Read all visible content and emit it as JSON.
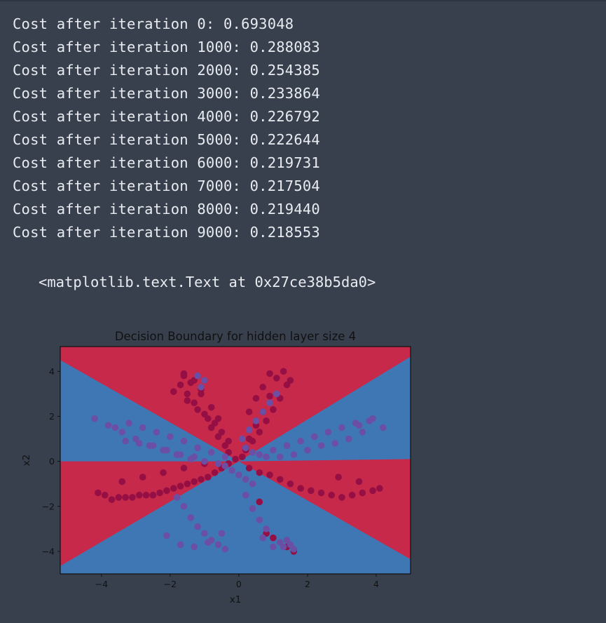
{
  "log_lines": [
    "Cost after iteration 0: 0.693048",
    "Cost after iteration 1000: 0.288083",
    "Cost after iteration 2000: 0.254385",
    "Cost after iteration 3000: 0.233864",
    "Cost after iteration 4000: 0.226792",
    "Cost after iteration 5000: 0.222644",
    "Cost after iteration 6000: 0.219731",
    "Cost after iteration 7000: 0.217504",
    "Cost after iteration 8000: 0.219440",
    "Cost after iteration 9000: 0.218553"
  ],
  "output_text": "<matplotlib.text.Text at 0x27ce38b5da0>",
  "chart_data": {
    "type": "scatter",
    "title": "Decision Boundary for hidden layer size 4",
    "xlabel": "x1",
    "ylabel": "x2",
    "xlim": [
      -5.2,
      5.0
    ],
    "ylim": [
      -5.0,
      5.1
    ],
    "xticks": [
      -4,
      -2,
      0,
      2,
      4
    ],
    "yticks": [
      -4,
      -2,
      0,
      2,
      4
    ],
    "colors": {
      "red_region": "#c6294a",
      "blue_region": "#3f77b4",
      "red_points": "#950f45",
      "blue_points": "#6a4fa5",
      "frame": "#111111"
    },
    "decision_regions": {
      "red": [
        [
          [
            -5.2,
            5.1
          ],
          [
            5.0,
            5.1
          ],
          [
            5.0,
            4.65
          ],
          [
            0,
            0
          ],
          [
            -5.2,
            4.5
          ]
        ],
        [
          [
            -5.2,
            0
          ],
          [
            0,
            0
          ],
          [
            5.0,
            0.1
          ],
          [
            5.0,
            -4.35
          ],
          [
            0,
            0
          ],
          [
            -5.2,
            -4.65
          ]
        ]
      ]
    },
    "series": [
      {
        "label_class": 0,
        "x": [
          -1.6,
          -1.3,
          -1.1,
          -1.9,
          -1.5,
          -1.2,
          -0.9,
          -0.8,
          -0.6,
          -0.4,
          -1.7,
          -1.5,
          -1.3,
          -1.0,
          -0.7,
          -0.5,
          -0.3,
          -1.6,
          -1.4,
          -1.1,
          -0.8,
          -0.6,
          -0.3,
          0.2,
          0.4,
          0.6,
          0.8,
          1.0,
          1.2,
          1.4,
          0.9,
          0.7,
          0.5,
          0.3,
          1.5,
          1.3,
          1.1,
          0.9,
          0.7,
          0.5,
          0.3,
          0.2,
          0.1,
          -0.1,
          -0.3,
          -0.5,
          -0.7,
          -0.9,
          -1.1,
          -1.3,
          -1.5,
          -1.7,
          -1.9,
          -2.1,
          -2.3,
          -2.5,
          -2.7,
          -2.9,
          -3.1,
          -3.3,
          -3.5,
          -3.7,
          -3.9,
          -4.1,
          -3.4,
          -2.8,
          -2.2,
          -1.6,
          -1.0,
          0.3,
          0.6,
          0.9,
          1.2,
          1.5,
          1.8,
          2.1,
          2.4,
          2.7,
          3.0,
          3.3,
          3.6,
          3.9,
          4.1,
          2.9,
          3.5,
          1.0,
          1.4,
          1.6,
          0.6,
          0.8
        ],
        "y": [
          3.9,
          3.6,
          3.2,
          3.1,
          2.7,
          2.3,
          1.9,
          1.5,
          1.1,
          0.7,
          3.4,
          3.0,
          2.6,
          2.1,
          1.7,
          1.3,
          0.9,
          3.8,
          3.5,
          3.0,
          2.4,
          1.9,
          0.4,
          0.6,
          0.9,
          1.3,
          1.8,
          2.3,
          2.8,
          3.4,
          3.9,
          3.3,
          2.8,
          2.2,
          3.6,
          4.0,
          3.7,
          2.9,
          2.2,
          1.6,
          1.0,
          0.5,
          0.2,
          0.1,
          -0.1,
          -0.3,
          -0.5,
          -0.7,
          -0.8,
          -0.9,
          -1.0,
          -1.1,
          -1.2,
          -1.3,
          -1.4,
          -1.5,
          -1.5,
          -1.5,
          -1.6,
          -1.6,
          -1.6,
          -1.7,
          -1.5,
          -1.4,
          -0.9,
          -0.7,
          -0.5,
          -0.3,
          -0.1,
          -0.3,
          -0.5,
          -0.6,
          -0.8,
          -1.0,
          -1.2,
          -1.3,
          -1.4,
          -1.5,
          -1.6,
          -1.5,
          -1.4,
          -1.3,
          -1.2,
          -0.7,
          -0.9,
          -3.4,
          -3.8,
          -4.0,
          -1.8,
          -3.2
        ]
      },
      {
        "label_class": 1,
        "x": [
          -4.2,
          -3.8,
          -3.4,
          -3.0,
          -2.6,
          -2.2,
          -1.8,
          -1.4,
          -1.0,
          -0.6,
          -3.6,
          -3.2,
          -2.8,
          -2.4,
          -2.0,
          -1.6,
          -1.2,
          -0.8,
          -0.4,
          -3.3,
          -2.9,
          -2.5,
          -2.1,
          -1.7,
          -1.3,
          -1.2,
          -1.0,
          -1.1,
          0.1,
          0.3,
          0.5,
          0.7,
          0.9,
          1.1,
          0.2,
          0.4,
          0.6,
          0.8,
          4.2,
          3.8,
          3.4,
          3.0,
          2.6,
          2.2,
          1.8,
          1.4,
          1.0,
          0.6,
          3.6,
          3.2,
          2.8,
          2.4,
          2.0,
          1.6,
          1.2,
          3.9,
          3.5,
          -1.8,
          -1.6,
          -1.4,
          -1.2,
          -1.0,
          -0.8,
          -0.6,
          -0.4,
          -2.1,
          -1.7,
          -1.3,
          -0.9,
          -0.5,
          1.0,
          1.2,
          1.4,
          1.6,
          0.8,
          0.6,
          0.4,
          0.2,
          1.3,
          1.5,
          0.7,
          -0.2,
          0.0,
          0.2,
          -0.4,
          0.4
        ],
        "y": [
          1.9,
          1.6,
          1.3,
          1.0,
          0.7,
          0.5,
          0.3,
          0.1,
          0.0,
          -0.1,
          1.5,
          1.7,
          1.5,
          1.3,
          1.1,
          0.9,
          0.6,
          0.4,
          0.2,
          0.9,
          0.8,
          0.7,
          0.5,
          0.3,
          0.2,
          3.8,
          3.6,
          3.3,
          1.0,
          1.4,
          1.8,
          2.2,
          2.6,
          3.0,
          0.6,
          0.4,
          0.3,
          0.2,
          1.5,
          1.8,
          1.7,
          1.5,
          1.3,
          1.1,
          0.9,
          0.7,
          0.5,
          0.3,
          1.3,
          1.0,
          0.8,
          0.7,
          0.5,
          0.3,
          0.2,
          1.9,
          1.6,
          -1.6,
          -2.0,
          -2.5,
          -2.9,
          -3.2,
          -3.5,
          -3.7,
          -3.9,
          -3.3,
          -3.7,
          -3.8,
          -3.6,
          -3.2,
          -3.8,
          -3.6,
          -3.5,
          -3.9,
          -3.0,
          -2.6,
          -2.1,
          -1.5,
          -3.8,
          -3.7,
          -3.4,
          -0.4,
          -0.6,
          -0.8,
          -0.2,
          -1.0
        ]
      }
    ]
  }
}
